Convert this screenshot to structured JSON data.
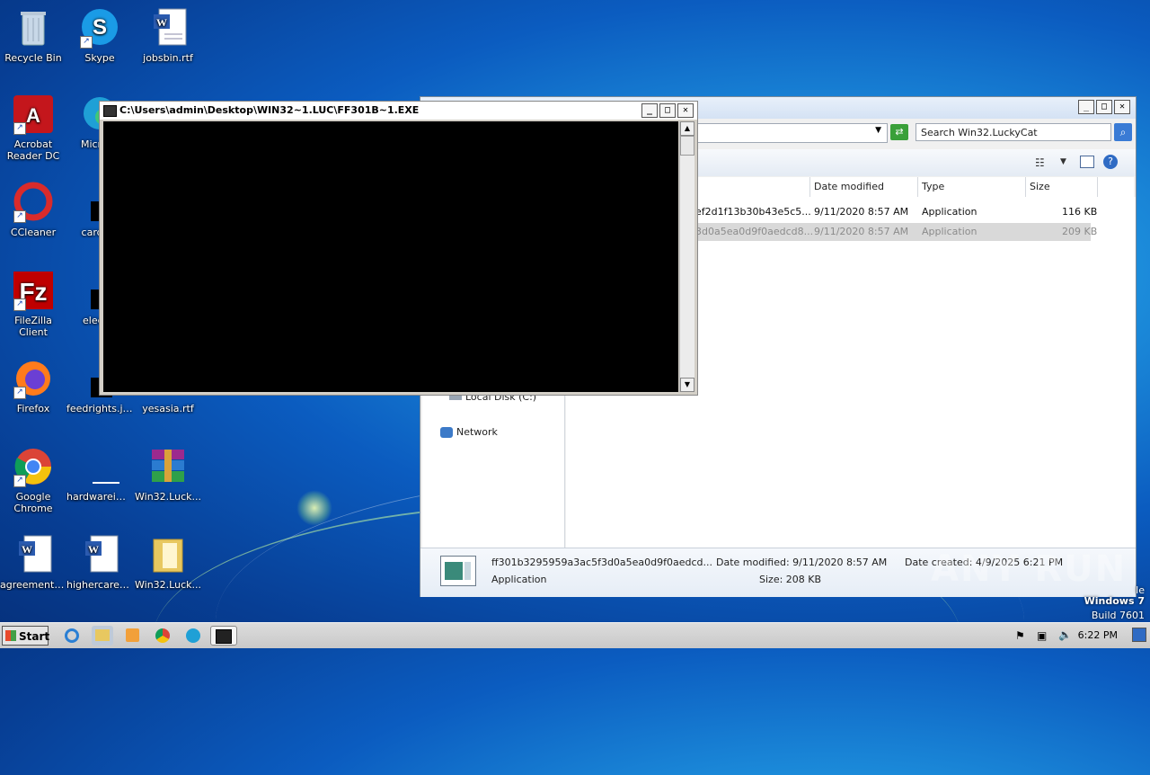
{
  "desktop": {
    "icons": [
      {
        "label": "Recycle Bin"
      },
      {
        "label": "Skype"
      },
      {
        "label": "jobsbin.rtf"
      },
      {
        "label": "Acrobat Reader DC"
      },
      {
        "label": "Microso"
      },
      {
        "label": "CCleaner"
      },
      {
        "label": "cardsre"
      },
      {
        "label": "FileZilla Client"
      },
      {
        "label": "electro"
      },
      {
        "label": "Firefox"
      },
      {
        "label": "feedrights.jpg"
      },
      {
        "label": "yesasia.rtf"
      },
      {
        "label": "Google Chrome"
      },
      {
        "label": "hardwareim..."
      },
      {
        "label": "Win32.Luck..."
      },
      {
        "label": "agreementb..."
      },
      {
        "label": "highercaree..."
      },
      {
        "label": "Win32.Luck..."
      }
    ]
  },
  "console": {
    "title": "C:\\Users\\admin\\Desktop\\WIN32~1.LUC\\FF301B~1.EXE"
  },
  "explorer": {
    "search_placeholder": "Search Win32.LuckyCat",
    "columns": {
      "date": "Date modified",
      "type": "Type",
      "size": "Size"
    },
    "files": [
      {
        "name_tail": "ef2d1f13b30b43e5c5...",
        "date": "9/11/2020 8:57 AM",
        "type": "Application",
        "size": "116 KB",
        "selected": false
      },
      {
        "name_tail": "3d0a5ea0d9f0aedcd8...",
        "date": "9/11/2020 8:57 AM",
        "type": "Application",
        "size": "209 KB",
        "selected": true
      }
    ],
    "nav": {
      "local_disk": "Local Disk (C:)",
      "network": "Network"
    },
    "details": {
      "filename": "ff301b3295959a3ac5f3d0a5ea0d9f0aedcd...",
      "type": "Application",
      "date_modified": "Date modified: 9/11/2020 8:57 AM",
      "size": "Size: 208 KB",
      "date_created": "Date created: 4/9/2025 6:21 PM"
    }
  },
  "taskbar": {
    "start_label": "Start",
    "clock": "6:22 PM"
  },
  "branding": {
    "os_partial": "le",
    "os_name": "Windows 7",
    "build": "Build 7601",
    "watermark": "ANY RUN"
  },
  "colors": {
    "accent": "#0b5cc0",
    "console_bg": "#000000",
    "selection": "#d9d9d9"
  }
}
